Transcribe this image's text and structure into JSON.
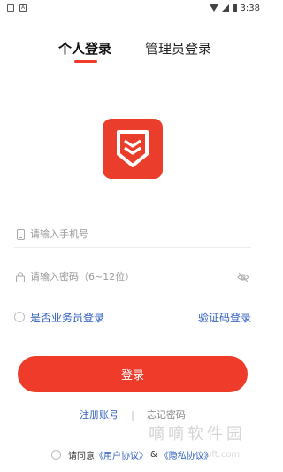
{
  "status_bar": {
    "time": "3:38"
  },
  "tabs": [
    {
      "label": "个人登录"
    },
    {
      "label": "管理员登录"
    }
  ],
  "form": {
    "phone_placeholder": "请输入手机号",
    "password_placeholder": "请输入密码（6~12位）",
    "salesman_label": "是否业务员登录",
    "code_login_label": "验证码登录",
    "login_label": "登录"
  },
  "links": {
    "register": "注册账号",
    "separator": "|",
    "forgot": "忘记密码"
  },
  "agreement": {
    "prefix": "请同意",
    "user_agreement": "《用户协议》",
    "amp": "&",
    "privacy": "《隐私协议》"
  },
  "watermark": {
    "text": "嘀嘀软件园",
    "url": "soft.com"
  },
  "colors": {
    "accent": "#ee3b2a",
    "link": "#2f5fbf"
  }
}
